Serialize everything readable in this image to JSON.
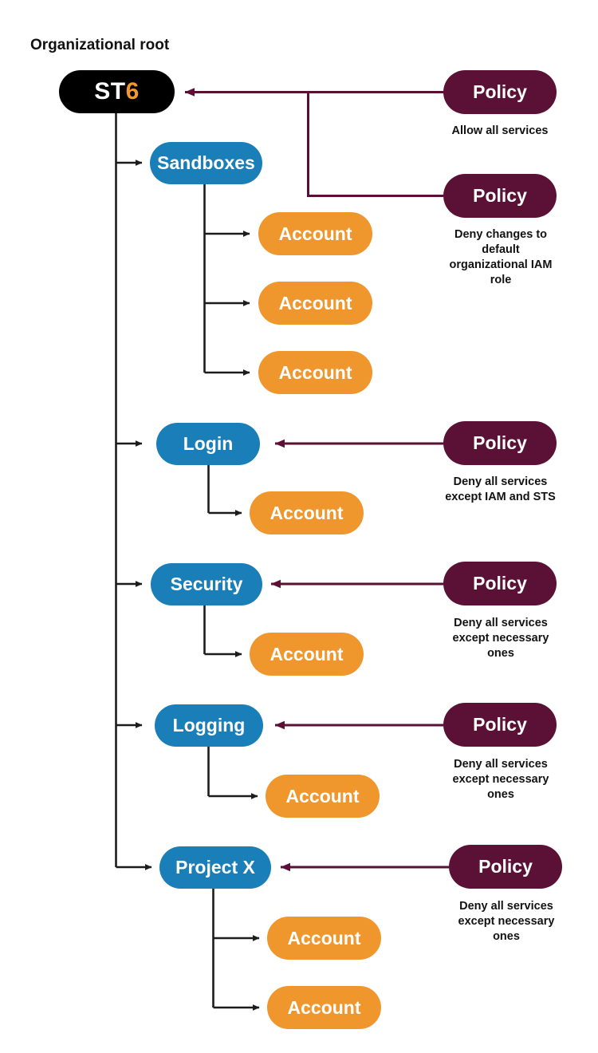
{
  "diagram": {
    "title_label": "Organizational root",
    "colors": {
      "root": "#000000",
      "root_text_primary": "#ffffff",
      "root_text_accent": "#f0982e",
      "ou": "#1a7eb8",
      "account": "#ef962d",
      "policy": "#5b1035",
      "edge_black": "#1c1c1c",
      "edge_maroon": "#5b1035",
      "background": "#ffffff",
      "caption_text": "#121212"
    },
    "root": {
      "label_prefix": "ST",
      "label_suffix": "6",
      "full_label": "ST6"
    },
    "ous": [
      {
        "id": "sandboxes",
        "label": "Sandboxes",
        "accounts": [
          "Account",
          "Account",
          "Account"
        ]
      },
      {
        "id": "login",
        "label": "Login",
        "accounts": [
          "Account"
        ]
      },
      {
        "id": "security",
        "label": "Security",
        "accounts": [
          "Account"
        ]
      },
      {
        "id": "logging",
        "label": "Logging",
        "accounts": [
          "Account"
        ]
      },
      {
        "id": "projectx",
        "label": "Project X",
        "accounts": [
          "Account",
          "Account"
        ]
      }
    ],
    "policies": [
      {
        "id": "policy-allow-all",
        "label": "Policy",
        "caption": "Allow all services",
        "attached_to": "root"
      },
      {
        "id": "policy-deny-iam-role",
        "label": "Policy",
        "caption_lines": [
          "Deny changes to",
          "default",
          "organizational IAM",
          "role"
        ],
        "caption": "Deny changes to default organizational IAM role",
        "attached_to": "root"
      },
      {
        "id": "policy-login",
        "label": "Policy",
        "caption_lines": [
          "Deny all services",
          "except IAM and STS"
        ],
        "caption": "Deny all services except IAM and STS",
        "attached_to": "login"
      },
      {
        "id": "policy-security",
        "label": "Policy",
        "caption_lines": [
          "Deny all services",
          "except necessary",
          "ones"
        ],
        "caption": "Deny all services except necessary ones",
        "attached_to": "security"
      },
      {
        "id": "policy-logging",
        "label": "Policy",
        "caption_lines": [
          "Deny all services",
          "except necessary",
          "ones"
        ],
        "caption": "Deny all services except necessary ones",
        "attached_to": "logging"
      },
      {
        "id": "policy-projectx",
        "label": "Policy",
        "caption_lines": [
          "Deny all services",
          "except necessary",
          "ones"
        ],
        "caption": "Deny all services except necessary ones",
        "attached_to": "projectx"
      }
    ],
    "accounts_flat": [
      "Account",
      "Account",
      "Account",
      "Account",
      "Account",
      "Account",
      "Account",
      "Account"
    ]
  }
}
